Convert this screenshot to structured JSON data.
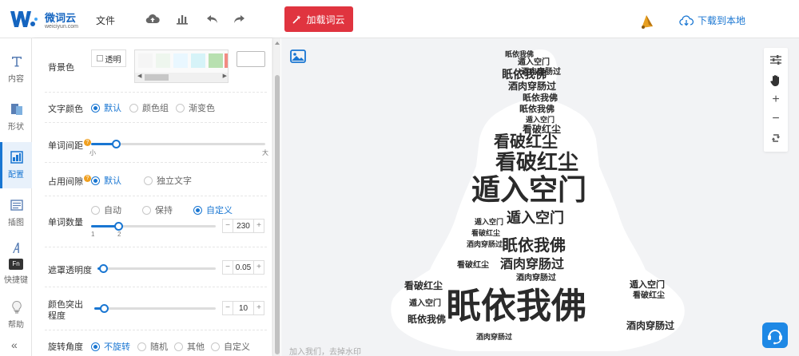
{
  "app": {
    "logo_title": "微词云",
    "logo_sub": "weiciyun.com",
    "menu_file": "文件",
    "load_button": "加载词云",
    "download": "下载到本地"
  },
  "nav": [
    {
      "label": "内容",
      "icon": "text-icon"
    },
    {
      "label": "形状",
      "icon": "shape-icon"
    },
    {
      "label": "配置",
      "icon": "config-icon",
      "active": true
    },
    {
      "label": "插图",
      "icon": "illustration-icon"
    },
    {
      "label": "快捷键",
      "icon": "font-shortcut-icon"
    },
    {
      "label": "帮助",
      "icon": "lightbulb-icon"
    }
  ],
  "settings": {
    "bg_label": "背景色",
    "bg_transparent": "透明",
    "text_color_label": "文字颜色",
    "text_color_options": [
      "默认",
      "颜色组",
      "渐变色"
    ],
    "word_spacing_label": "单词间距",
    "word_spacing_min": "小",
    "word_spacing_max": "大",
    "word_spacing_level": 0.14,
    "occupy_label": "占用间隙",
    "occupy_options": [
      "默认",
      "独立文字"
    ],
    "word_count_label": "单词数量",
    "word_count_options": [
      "自动",
      "保持",
      "自定义"
    ],
    "word_count_tick_1": "1",
    "word_count_tick_2": "2",
    "word_count_value": "230",
    "word_count_level": 0.22,
    "mask_opacity_label": "遮罩透明度",
    "mask_opacity_value": "0.05",
    "mask_opacity_level": 0.05,
    "color_highlight_label_1": "颜色突出",
    "color_highlight_label_2": "程度",
    "color_highlight_value": "10",
    "color_highlight_level": 0.08,
    "rotation_label": "旋转角度",
    "rotation_options": [
      "不旋转",
      "随机",
      "其他",
      "自定义"
    ],
    "stepper_minus": "−",
    "stepper_plus": "+"
  },
  "canvas": {
    "watermark": "加入我们，去掉水印",
    "words": {
      "w1": "眂依我佛",
      "w2": "遁入空门",
      "w3": "看破红尘",
      "w4": "酒肉穿肠过",
      "w5": "眂依我佛",
      "w6": "遁入空门",
      "w7": "看破红尘",
      "w8": "酒肉穿肠过",
      "w9": "眂依我佛",
      "w10": "遁入空门",
      "w11": "看破红尘",
      "w12": "酒肉穿肠过",
      "w13": "眂依我佛",
      "w14": "遁入空门",
      "w15": "看破红尘",
      "w16": "酒肉穿肠过",
      "w17": "眂依我佛",
      "w18": "遁入空门",
      "w19": "看破红尘",
      "w20": "酒肉穿肠过",
      "w21": "眂依我佛",
      "w22": "遁入空门",
      "w23": "看破红尘",
      "w24": "酒肉穿肠过",
      "w25": "眂依我佛",
      "w26": "遁入空门",
      "w27": "看破红尘",
      "w28": "酒肉穿肠过"
    }
  },
  "colors": {
    "accent": "#1976d2",
    "load_button": "#e0343f",
    "swatches": [
      "#f5f5f5",
      "#eef6ee",
      "#e9f7ff",
      "#d6f3f8",
      "#dff0d8",
      "#b8e0b0"
    ]
  }
}
